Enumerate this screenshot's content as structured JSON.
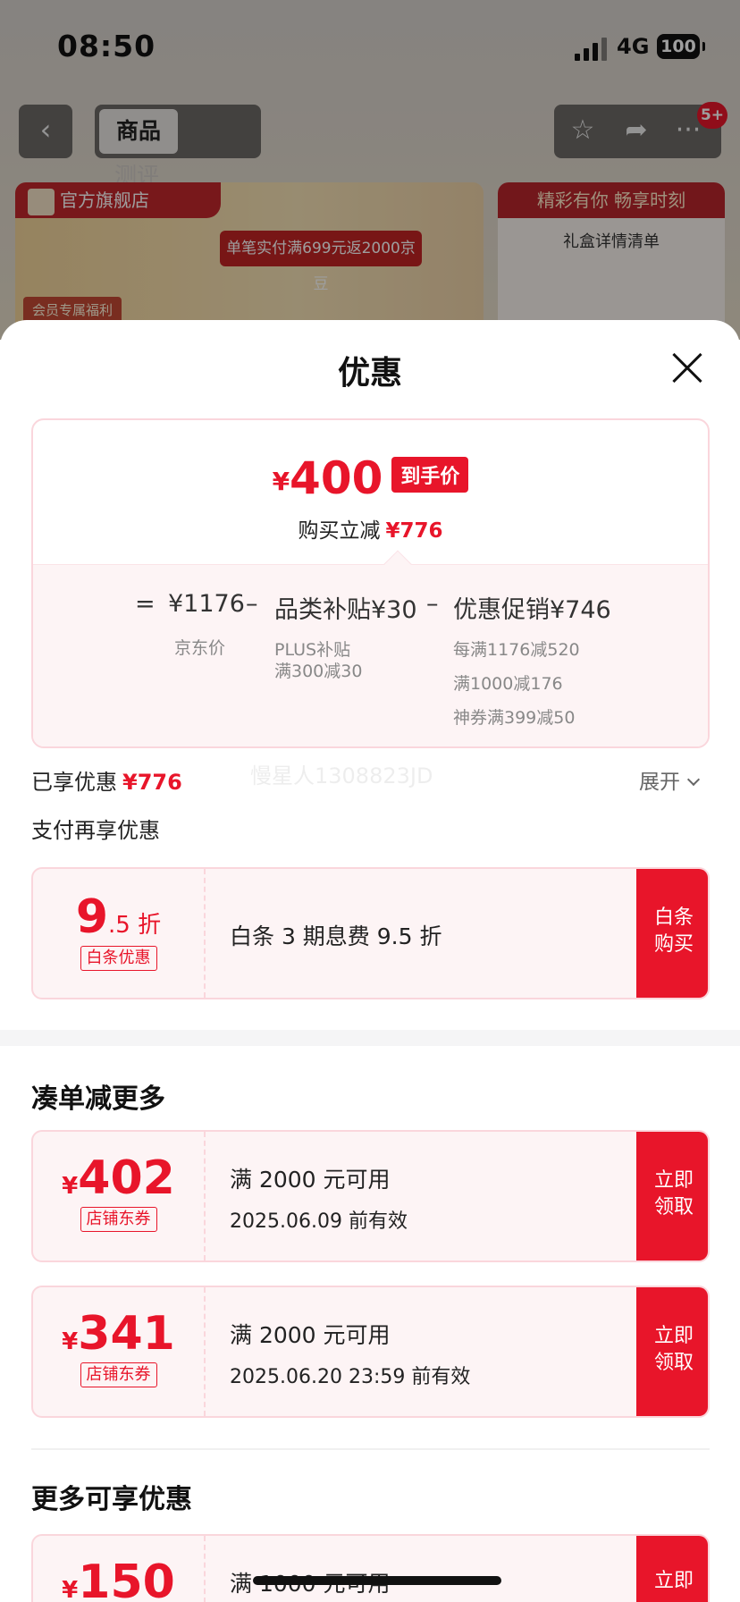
{
  "status_bar": {
    "time": "08:50",
    "network": "4G",
    "battery": "100"
  },
  "nav": {
    "back_icon": "chevron-left-icon",
    "tabs": [
      {
        "label": "商品"
      },
      {
        "label": "测评"
      }
    ],
    "badge": "5+"
  },
  "banner": {
    "shop_name": "官方旗舰店",
    "promo": "单笔实付满699元返2000京豆",
    "member": "会员专属福利",
    "right_top": "精彩有你 畅享时刻",
    "right_sub": "礼盒详情清单"
  },
  "sheet": {
    "title": "优惠",
    "final_currency": "¥",
    "final_price": "400",
    "final_tag": "到手价",
    "save_label": "购买立减",
    "save_amount": "¥776",
    "formula": {
      "eq": "=",
      "jd_price": "¥1176",
      "minus1": "–",
      "subsidy": "品类补贴¥30",
      "minus2": "–",
      "promo": "优惠促销¥746",
      "jd_price_label": "京东价",
      "subsidy_detail": [
        "PLUS补贴",
        "满300减30"
      ],
      "promo_detail": [
        "每满1176减520",
        "满1000减176",
        "神券满399减50"
      ]
    },
    "enjoyed_label": "已享优惠",
    "enjoyed_amount": "¥776",
    "expand_label": "展开",
    "watermark": "慢星人1308823JD",
    "pay_more_title": "支付再享优惠",
    "baitiao": {
      "big": "9",
      "small": ".5 折",
      "tag": "白条优惠",
      "desc": "白条 3 期息费 9.5 折",
      "btn": "白条购买"
    },
    "section_more": "凑单减更多",
    "coupons": [
      {
        "currency": "¥",
        "amount": "402",
        "tag": "店铺东券",
        "line1": "满 2000 元可用",
        "line2": "2025.06.09 前有效",
        "btn": "立即领取"
      },
      {
        "currency": "¥",
        "amount": "341",
        "tag": "店铺东券",
        "line1": "满 2000 元可用",
        "line2": "2025.06.20 23:59 前有效",
        "btn": "立即领取"
      }
    ],
    "section_more2": "更多可享优惠",
    "coupon3": {
      "currency": "¥",
      "amount": "150",
      "line1": "满 1000 元可用",
      "btn": "立即"
    }
  },
  "colors": {
    "accent": "#e8152a",
    "pink_border": "#fad6dc",
    "pink_bg": "#fdf4f5"
  }
}
